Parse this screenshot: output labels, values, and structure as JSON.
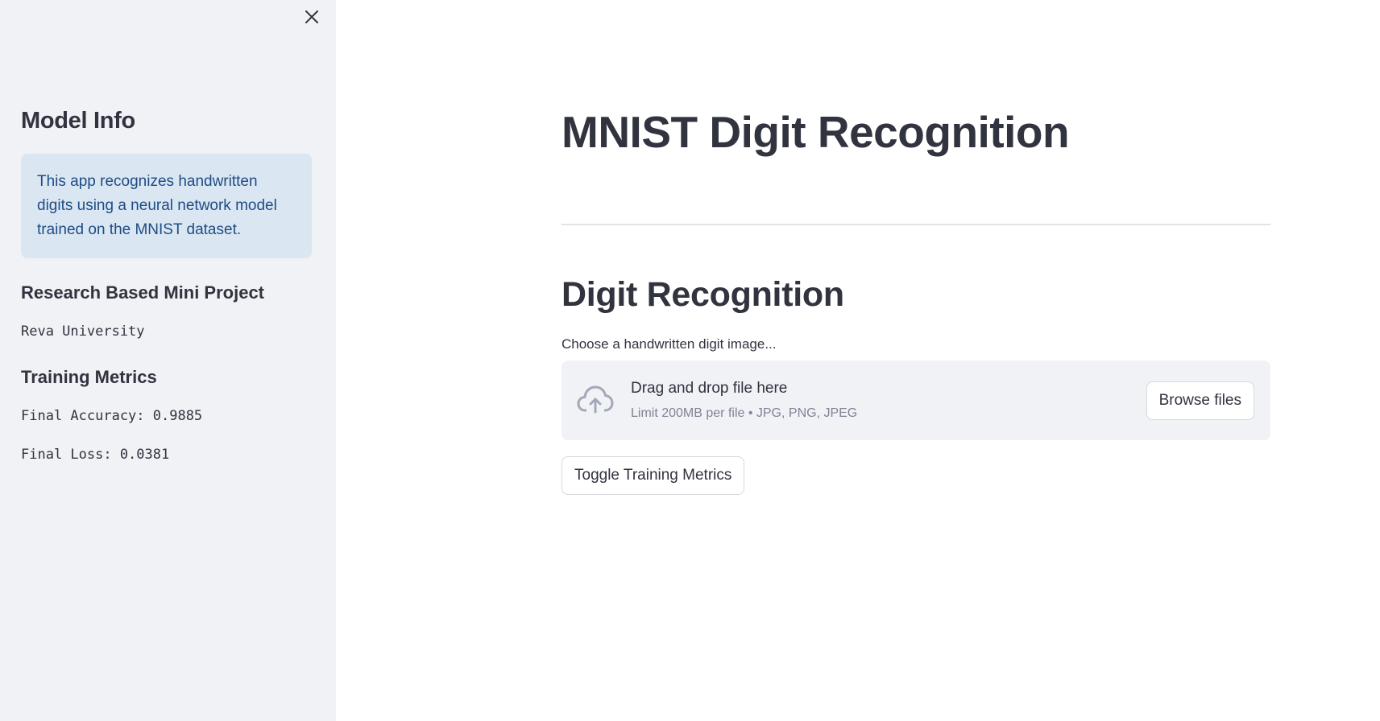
{
  "sidebar": {
    "close_icon": "close-icon",
    "heading": "Model Info",
    "info_text": "This app recognizes handwritten digits using a neural network model trained on the MNIST dataset.",
    "project_title": "Research Based Mini Project",
    "university": "Reva University",
    "metrics_title": "Training Metrics",
    "final_accuracy": "Final Accuracy: 0.9885",
    "final_loss": "Final Loss: 0.0381"
  },
  "main": {
    "title": "MNIST Digit Recognition",
    "section_title": "Digit Recognition",
    "uploader": {
      "label": "Choose a handwritten digit image...",
      "icon": "cloud-upload-icon",
      "drop_text": "Drag and drop file here",
      "limit_text": "Limit 200MB per file • JPG, PNG, JPEG",
      "browse_label": "Browse files"
    },
    "toggle_label": "Toggle Training Metrics"
  },
  "colors": {
    "sidebar_bg": "#f0f2f6",
    "info_bg": "#dbe6f3",
    "info_text": "#1d4d84",
    "text": "#31333f",
    "muted": "#808495"
  }
}
